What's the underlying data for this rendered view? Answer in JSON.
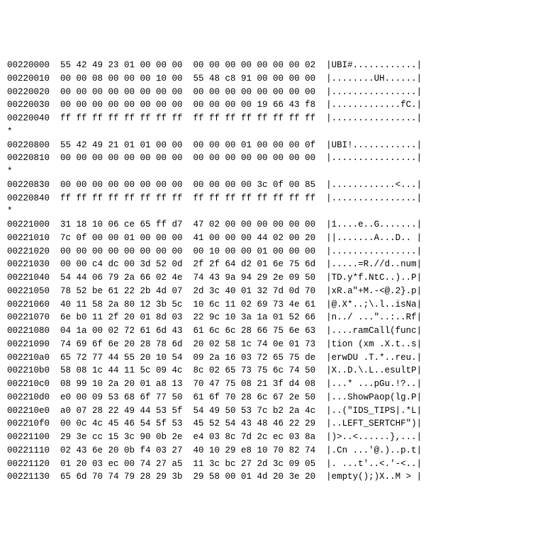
{
  "hexdump": {
    "rows": [
      {
        "offset": "00220000",
        "b1": "55 42 49 23 01 00 00 00",
        "b2": "00 00 00 00 00 00 00 02",
        "ascii": "|UBI#............|"
      },
      {
        "offset": "00220010",
        "b1": "00 00 08 00 00 00 10 00",
        "b2": "55 48 c8 91 00 00 00 00",
        "ascii": "|........UH......|"
      },
      {
        "offset": "00220020",
        "b1": "00 00 00 00 00 00 00 00",
        "b2": "00 00 00 00 00 00 00 00",
        "ascii": "|................|"
      },
      {
        "offset": "00220030",
        "b1": "00 00 00 00 00 00 00 00",
        "b2": "00 00 00 00 19 66 43 f8",
        "ascii": "|.............fC.|"
      },
      {
        "offset": "00220040",
        "b1": "ff ff ff ff ff ff ff ff",
        "b2": "ff ff ff ff ff ff ff ff",
        "ascii": "|................|"
      },
      {
        "star": "*"
      },
      {
        "offset": "00220800",
        "b1": "55 42 49 21 01 01 00 00",
        "b2": "00 00 00 01 00 00 00 0f",
        "ascii": "|UBI!............|"
      },
      {
        "offset": "00220810",
        "b1": "00 00 00 00 00 00 00 00",
        "b2": "00 00 00 00 00 00 00 00",
        "ascii": "|................|"
      },
      {
        "star": "*"
      },
      {
        "offset": "00220830",
        "b1": "00 00 00 00 00 00 00 00",
        "b2": "00 00 00 00 3c 0f 00 85",
        "ascii": "|............<...|"
      },
      {
        "offset": "00220840",
        "b1": "ff ff ff ff ff ff ff ff",
        "b2": "ff ff ff ff ff ff ff ff",
        "ascii": "|................|"
      },
      {
        "star": "*"
      },
      {
        "offset": "00221000",
        "b1": "31 18 10 06 ce 65 ff d7",
        "b2": "47 02 00 00 00 00 00 00",
        "ascii": "|1....e..G.......|"
      },
      {
        "offset": "00221010",
        "b1": "7c 0f 00 00 01 00 00 00",
        "b2": "41 00 00 00 44 02 00 20",
        "ascii": "||.......A...D.. |"
      },
      {
        "offset": "00221020",
        "b1": "00 00 00 00 00 00 00 00",
        "b2": "00 10 00 00 01 00 00 00",
        "ascii": "|................|"
      },
      {
        "offset": "00221030",
        "b1": "00 00 c4 dc 00 3d 52 0d",
        "b2": "2f 2f 64 d2 01 6e 75 6d",
        "ascii": "|.....=R.//d..num|"
      },
      {
        "offset": "00221040",
        "b1": "54 44 06 79 2a 66 02 4e",
        "b2": "74 43 9a 94 29 2e 09 50",
        "ascii": "|TD.y*f.NtC..)..P|"
      },
      {
        "offset": "00221050",
        "b1": "78 52 be 61 22 2b 4d 07",
        "b2": "2d 3c 40 01 32 7d 0d 70",
        "ascii": "|xR.a\"+M.-<@.2}.p|"
      },
      {
        "offset": "00221060",
        "b1": "40 11 58 2a 80 12 3b 5c",
        "b2": "10 6c 11 02 69 73 4e 61",
        "ascii": "|@.X*..;\\.l..isNa|"
      },
      {
        "offset": "00221070",
        "b1": "6e b0 11 2f 20 01 8d 03",
        "b2": "22 9c 10 3a 1a 01 52 66",
        "ascii": "|n../ ...\"..:..Rf|"
      },
      {
        "offset": "00221080",
        "b1": "04 1a 00 02 72 61 6d 43",
        "b2": "61 6c 6c 28 66 75 6e 63",
        "ascii": "|....ramCall(func|"
      },
      {
        "offset": "00221090",
        "b1": "74 69 6f 6e 20 28 78 6d",
        "b2": "20 02 58 1c 74 0e 01 73",
        "ascii": "|tion (xm .X.t..s|"
      },
      {
        "offset": "002210a0",
        "b1": "65 72 77 44 55 20 10 54",
        "b2": "09 2a 16 03 72 65 75 de",
        "ascii": "|erwDU .T.*..reu.|"
      },
      {
        "offset": "002210b0",
        "b1": "58 08 1c 44 11 5c 09 4c",
        "b2": "8c 02 65 73 75 6c 74 50",
        "ascii": "|X..D.\\.L..esultP|"
      },
      {
        "offset": "002210c0",
        "b1": "08 99 10 2a 20 01 a8 13",
        "b2": "70 47 75 08 21 3f d4 08",
        "ascii": "|...* ...pGu.!?..|"
      },
      {
        "offset": "002210d0",
        "b1": "e0 00 09 53 68 6f 77 50",
        "b2": "61 6f 70 28 6c 67 2e 50",
        "ascii": "|...ShowPaop(lg.P|"
      },
      {
        "offset": "002210e0",
        "b1": "a0 07 28 22 49 44 53 5f",
        "b2": "54 49 50 53 7c b2 2a 4c",
        "ascii": "|..(\"IDS_TIPS|.*L|"
      },
      {
        "offset": "002210f0",
        "b1": "00 0c 4c 45 46 54 5f 53",
        "b2": "45 52 54 43 48 46 22 29",
        "ascii": "|..LEFT_SERTCHF\")|"
      },
      {
        "offset": "00221100",
        "b1": "29 3e cc 15 3c 90 0b 2e",
        "b2": "e4 03 8c 7d 2c ec 03 8a",
        "ascii": "|)>..<......},...|"
      },
      {
        "offset": "00221110",
        "b1": "02 43 6e 20 0b f4 03 27",
        "b2": "40 10 29 e8 10 70 82 74",
        "ascii": "|.Cn ...'@.)..p.t|"
      },
      {
        "offset": "00221120",
        "b1": "01 20 03 ec 00 74 27 a5",
        "b2": "11 3c bc 27 2d 3c 09 05",
        "ascii": "|. ...t'..<.'-<..|"
      },
      {
        "offset": "00221130",
        "b1": "65 6d 70 74 79 28 29 3b",
        "b2": "29 58 00 01 4d 20 3e 20",
        "ascii": "|empty();)X..M > |"
      }
    ]
  }
}
